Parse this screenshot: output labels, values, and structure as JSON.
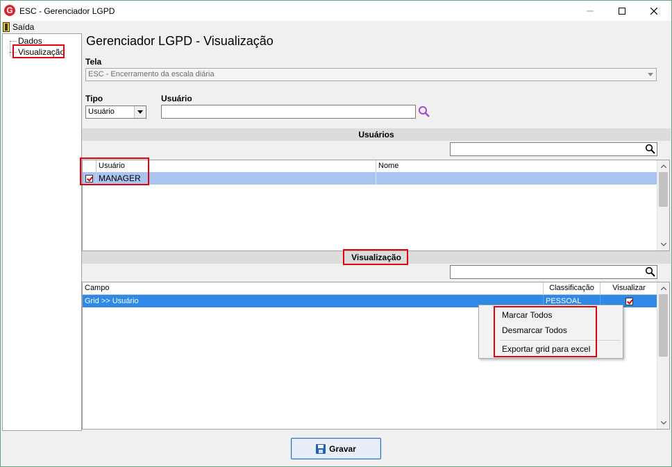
{
  "window": {
    "title": "ESC - Gerenciador LGPD",
    "app_icon_letter": "G"
  },
  "menu": {
    "exit_label": "Saída"
  },
  "tree": {
    "items": [
      {
        "label": "Dados"
      },
      {
        "label": "Visualização"
      }
    ]
  },
  "page": {
    "heading": "Gerenciador LGPD - Visualização"
  },
  "tela": {
    "label": "Tela",
    "value": "ESC - Encerramento da escala diária"
  },
  "tipo": {
    "label": "Tipo",
    "value": "Usuário"
  },
  "usuario": {
    "label": "Usuário",
    "value": ""
  },
  "users_section": {
    "title": "Usuários",
    "search_value": "",
    "columns": [
      "Usuário",
      "Nome"
    ],
    "rows": [
      {
        "usuario": "MANAGER",
        "nome": "",
        "checked": true
      }
    ]
  },
  "view_section": {
    "title": "Visualização",
    "search_value": "",
    "columns": [
      "Campo",
      "Classificação",
      "Visualizar"
    ],
    "rows": [
      {
        "campo": "Grid >> Usuário",
        "classificacao": "PESSOAL",
        "visualizar": true
      }
    ]
  },
  "context_menu": {
    "items": [
      "Marcar Todos",
      "Desmarcar Todos",
      "Exportar grid para excel"
    ]
  },
  "save_button": {
    "label": "Gravar"
  },
  "colors": {
    "selected_row_users": "#a9c4ee",
    "selected_row_view": "#2e8ae6",
    "highlight_box": "#e3000f"
  }
}
